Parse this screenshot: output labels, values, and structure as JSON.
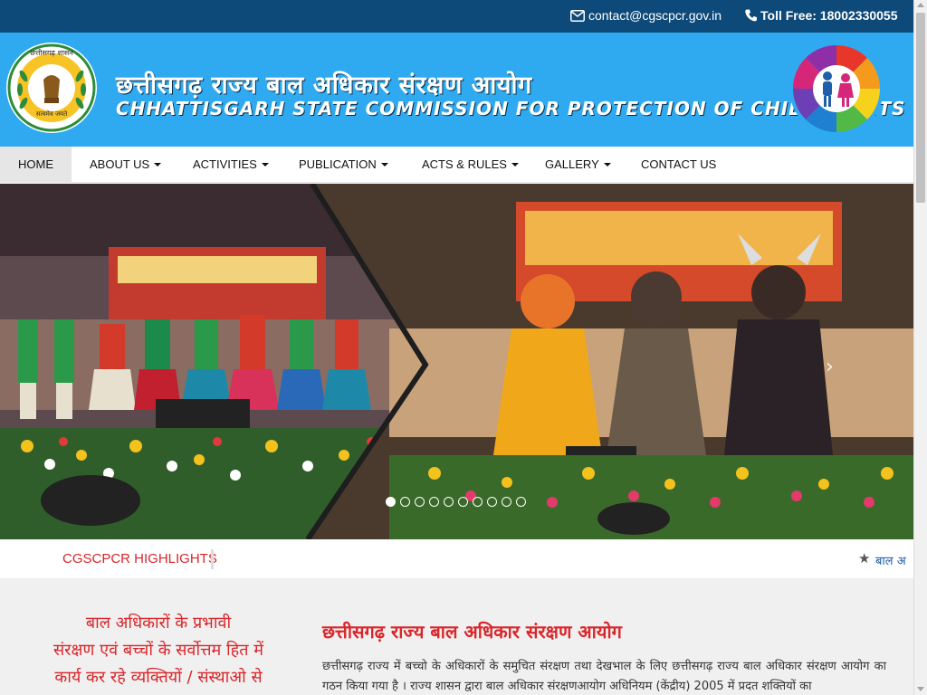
{
  "topbar": {
    "email": "contact@cgscpcr.gov.in",
    "phone": "Toll Free: 18002330055",
    "email_icon": "envelope-icon",
    "phone_icon": "phone-icon"
  },
  "header": {
    "title_hindi": "छत्तीसगढ़ राज्य बाल अधिकार संरक्षण आयोग",
    "title_english": "CHHATTISGARH STATE COMMISSION FOR PROTECTION OF CHILD RIGHTS",
    "emblem_text_top": "छत्तीसगढ़ शासन",
    "emblem_text_bottom": "सत्यमेव जयते",
    "emblem_icon": "state-emblem-icon",
    "logo_icon": "child-rights-logo-icon"
  },
  "nav": {
    "items": [
      {
        "label": "HOME",
        "active": true,
        "dropdown": false
      },
      {
        "label": "ABOUT US",
        "active": false,
        "dropdown": true
      },
      {
        "label": "ACTIVITIES",
        "active": false,
        "dropdown": true
      },
      {
        "label": "PUBLICATION",
        "active": false,
        "dropdown": true
      },
      {
        "label": "ACTS & RULES",
        "active": false,
        "dropdown": true
      },
      {
        "label": "GALLERY",
        "active": false,
        "dropdown": true
      },
      {
        "label": "CONTACT US",
        "active": false,
        "dropdown": false
      }
    ]
  },
  "slider": {
    "slide_count": 10,
    "active_slide": 1,
    "next_icon": "chevron-right-icon"
  },
  "highlights": {
    "title": "CGSCPCR HIGHLIGHTS",
    "ticker_text": "बाल अ",
    "star_icon": "star-icon"
  },
  "content": {
    "left_line1": "बाल अधिकारों के प्रभावी",
    "left_line2": "संरक्षण एवं बच्चों के सर्वोत्तम हित में",
    "left_line3": "कार्य कर रहे व्यक्तियों / संस्थाओ से",
    "heading": "छत्तीसगढ़ राज्य बाल अधिकार संरक्षण आयोग",
    "paragraph": "छत्तीसगढ़ राज्य में बच्चो के अधिकारों के समुचित संरक्षण तथा देखभाल के लिए छत्तीसगढ़ राज्य बाल अधिकार संरक्षण आयोग का गठन किया गया है । राज्य शासन द्वारा बाल अधिकार संरक्षणआयोग अधिनियम (केंद्रीय) 2005 में प्रदत शक्तियों का"
  },
  "colors": {
    "topbar_bg": "#0d4a7a",
    "header_bg": "#2faaf0",
    "accent_red": "#d9262b",
    "content_bg": "#f0f0f0"
  }
}
